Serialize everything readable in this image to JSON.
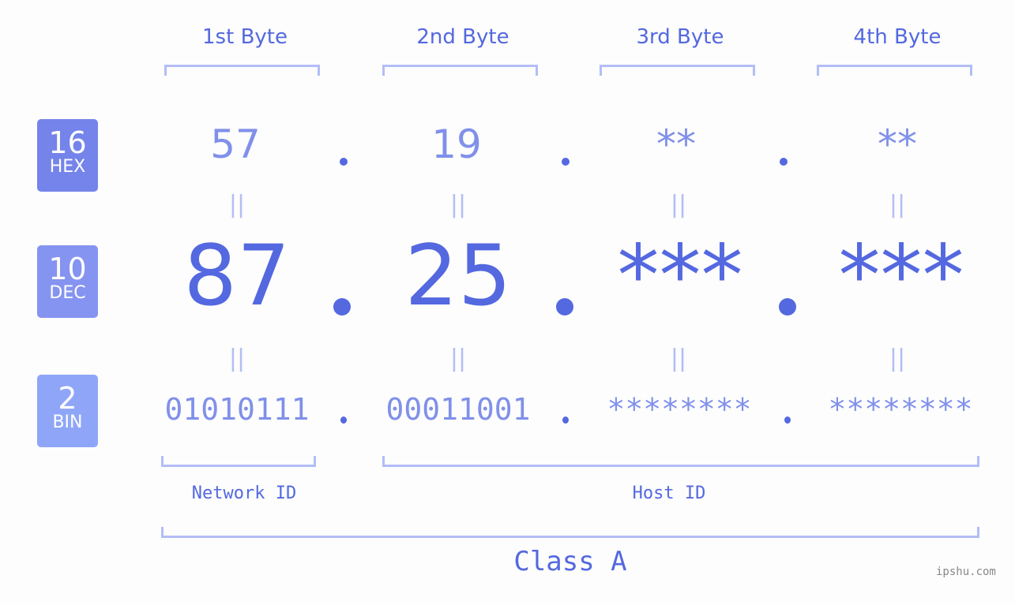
{
  "bytes": [
    {
      "label": "1st Byte",
      "hex": "57",
      "dec": "87",
      "bin": "01010111"
    },
    {
      "label": "2nd Byte",
      "hex": "19",
      "dec": "25",
      "bin": "00011001"
    },
    {
      "label": "3rd Byte",
      "hex": "**",
      "dec": "***",
      "bin": "********"
    },
    {
      "label": "4th Byte",
      "hex": "**",
      "dec": "***",
      "bin": "********"
    }
  ],
  "bases": {
    "hex": {
      "num": "16",
      "label": "HEX",
      "color": "#7584ea"
    },
    "dec": {
      "num": "10",
      "label": "DEC",
      "color": "#8594f0"
    },
    "bin": {
      "num": "2",
      "label": "BIN",
      "color": "#8fa6f8"
    }
  },
  "equals": "||",
  "parts": {
    "network": "Network ID",
    "host": "Host ID"
  },
  "class_label": "Class A",
  "watermark": "ipshu.com",
  "colors": {
    "accent": "#5468e0",
    "light": "#8090ea",
    "bracket": "#b3bdf6"
  }
}
